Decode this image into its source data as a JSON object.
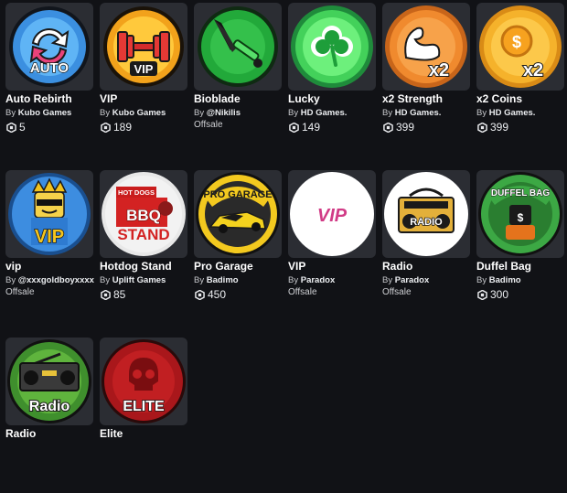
{
  "items": [
    {
      "name": "Auto Rebirth",
      "by": "By",
      "creator": "Kubo Games",
      "price": "5",
      "offsale": ""
    },
    {
      "name": "VIP",
      "by": "By",
      "creator": "Kubo Games",
      "price": "189",
      "offsale": ""
    },
    {
      "name": "Bioblade",
      "by": "By",
      "creator": "@Nikilis",
      "price": "",
      "offsale": "Offsale"
    },
    {
      "name": "Lucky",
      "by": "By",
      "creator": "HD Games.",
      "price": "149",
      "offsale": ""
    },
    {
      "name": "x2 Strength",
      "by": "By",
      "creator": "HD Games.",
      "price": "399",
      "offsale": ""
    },
    {
      "name": "x2 Coins",
      "by": "By",
      "creator": "HD Games.",
      "price": "399",
      "offsale": ""
    },
    {
      "name": "vip",
      "by": "By",
      "creator": "@xxxgoldboyxxxx",
      "price": "",
      "offsale": "Offsale"
    },
    {
      "name": "Hotdog Stand",
      "by": "By",
      "creator": "Uplift Games",
      "price": "85",
      "offsale": ""
    },
    {
      "name": "Pro Garage",
      "by": "By",
      "creator": "Badimo",
      "price": "450",
      "offsale": ""
    },
    {
      "name": "VIP",
      "by": "By",
      "creator": "Paradox",
      "price": "",
      "offsale": "Offsale"
    },
    {
      "name": "Radio",
      "by": "By",
      "creator": "Paradox",
      "price": "",
      "offsale": "Offsale"
    },
    {
      "name": "Duffel Bag",
      "by": "By",
      "creator": "Badimo",
      "price": "300",
      "offsale": ""
    },
    {
      "name": "Radio",
      "by": "",
      "creator": "",
      "price": "",
      "offsale": ""
    },
    {
      "name": "Elite",
      "by": "",
      "creator": "",
      "price": "",
      "offsale": ""
    }
  ],
  "art": {
    "auto_text": "AUTO",
    "vip_text": "VIP",
    "x2_text": "x2",
    "hotdog_sign": "HOT DOGS",
    "bbq_text": "BBQ",
    "stand_text": "STAND",
    "garage_text": "PRO GARAGE",
    "radio_text": "RADIO",
    "duffel_text": "DUFFEL BAG",
    "radio2_text": "Radio",
    "elite_text": "ELITE"
  },
  "colors": {
    "background": "#111216",
    "card": "#2b2d33"
  },
  "icons": [
    "robux-icon"
  ]
}
